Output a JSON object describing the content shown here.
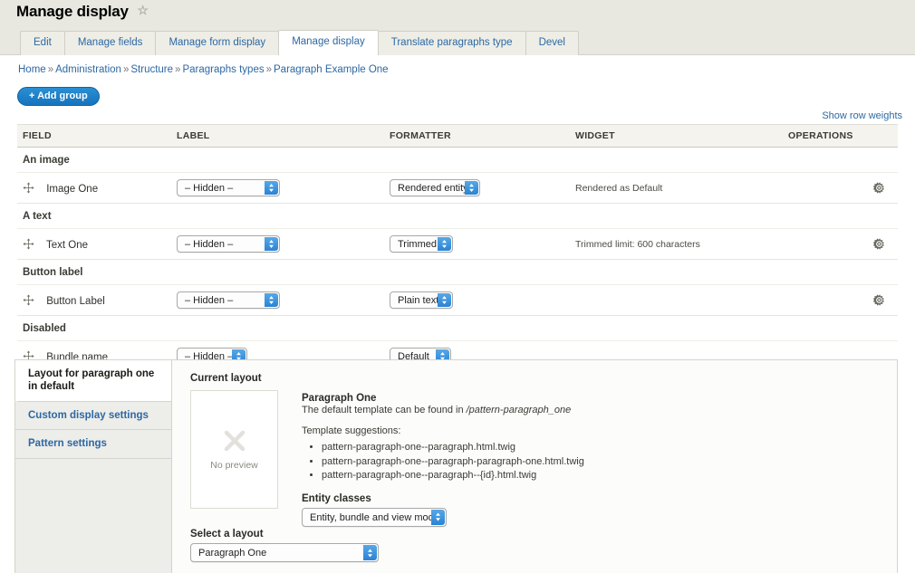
{
  "header": {
    "title": "Manage display",
    "star_icon": "star-outline-icon"
  },
  "tabs": [
    {
      "label": "Edit",
      "active": false
    },
    {
      "label": "Manage fields",
      "active": false
    },
    {
      "label": "Manage form display",
      "active": false
    },
    {
      "label": "Manage display",
      "active": true
    },
    {
      "label": "Translate paragraphs type",
      "active": false
    },
    {
      "label": "Devel",
      "active": false
    }
  ],
  "breadcrumb": {
    "items": [
      "Home",
      "Administration",
      "Structure",
      "Paragraphs types",
      "Paragraph Example One"
    ],
    "separator": "»"
  },
  "toolbar": {
    "add_group_label": "+ Add group"
  },
  "table": {
    "show_row_weights_label": "Show row weights",
    "columns": [
      "FIELD",
      "LABEL",
      "FORMATTER",
      "WIDGET",
      "OPERATIONS"
    ],
    "groups": [
      {
        "group_label": "An image",
        "rows": [
          {
            "field": "Image One",
            "label_select": "– Hidden –",
            "formatter_select": "Rendered entity",
            "widget_summary": "Rendered as Default",
            "has_gear": true,
            "label_width": "wide",
            "formatter_width": "rendered"
          }
        ]
      },
      {
        "group_label": "A text",
        "rows": [
          {
            "field": "Text One",
            "label_select": "– Hidden –",
            "formatter_select": "Trimmed",
            "widget_summary": "Trimmed limit: 600 characters",
            "has_gear": true,
            "label_width": "wide",
            "formatter_width": "trimmed"
          }
        ]
      },
      {
        "group_label": "Button label",
        "rows": [
          {
            "field": "Button Label",
            "label_select": "– Hidden –",
            "formatter_select": "Plain text",
            "widget_summary": "",
            "has_gear": true,
            "label_width": "wide",
            "formatter_width": "plain"
          }
        ]
      },
      {
        "group_label": "Disabled",
        "rows": [
          {
            "field": "Bundle name",
            "label_select": "– Hidden –",
            "formatter_select": "Default",
            "widget_summary": "",
            "has_gear": false,
            "label_width": "narrow",
            "formatter_width": "default"
          }
        ]
      }
    ]
  },
  "vertical_tabs": [
    {
      "label": "Layout for paragraph one in default",
      "active": true
    },
    {
      "label": "Custom display settings",
      "active": false
    },
    {
      "label": "Pattern settings",
      "active": false
    }
  ],
  "layout_panel": {
    "current_layout_title": "Current layout",
    "preview_caption": "No preview",
    "preview_icon": "x-placeholder-icon",
    "layout_name": "Paragraph One",
    "default_template_prefix": "The default template can be found in ",
    "default_template_path": "/pattern-paragraph_one",
    "suggestions_title": "Template suggestions:",
    "suggestions": [
      "pattern-paragraph-one--paragraph.html.twig",
      "pattern-paragraph-one--paragraph-paragraph-one.html.twig",
      "pattern-paragraph-one--paragraph--{id}.html.twig"
    ],
    "entity_classes_title": "Entity classes",
    "entity_classes_value": "Entity, bundle and view mode",
    "select_layout_title": "Select a layout",
    "select_layout_value": "Paragraph One"
  },
  "colors": {
    "accent_blue": "#2d68a3",
    "button_blue": "#1573bd",
    "header_bg": "#e8e8e0",
    "table_head_bg": "#f4f3ee"
  }
}
